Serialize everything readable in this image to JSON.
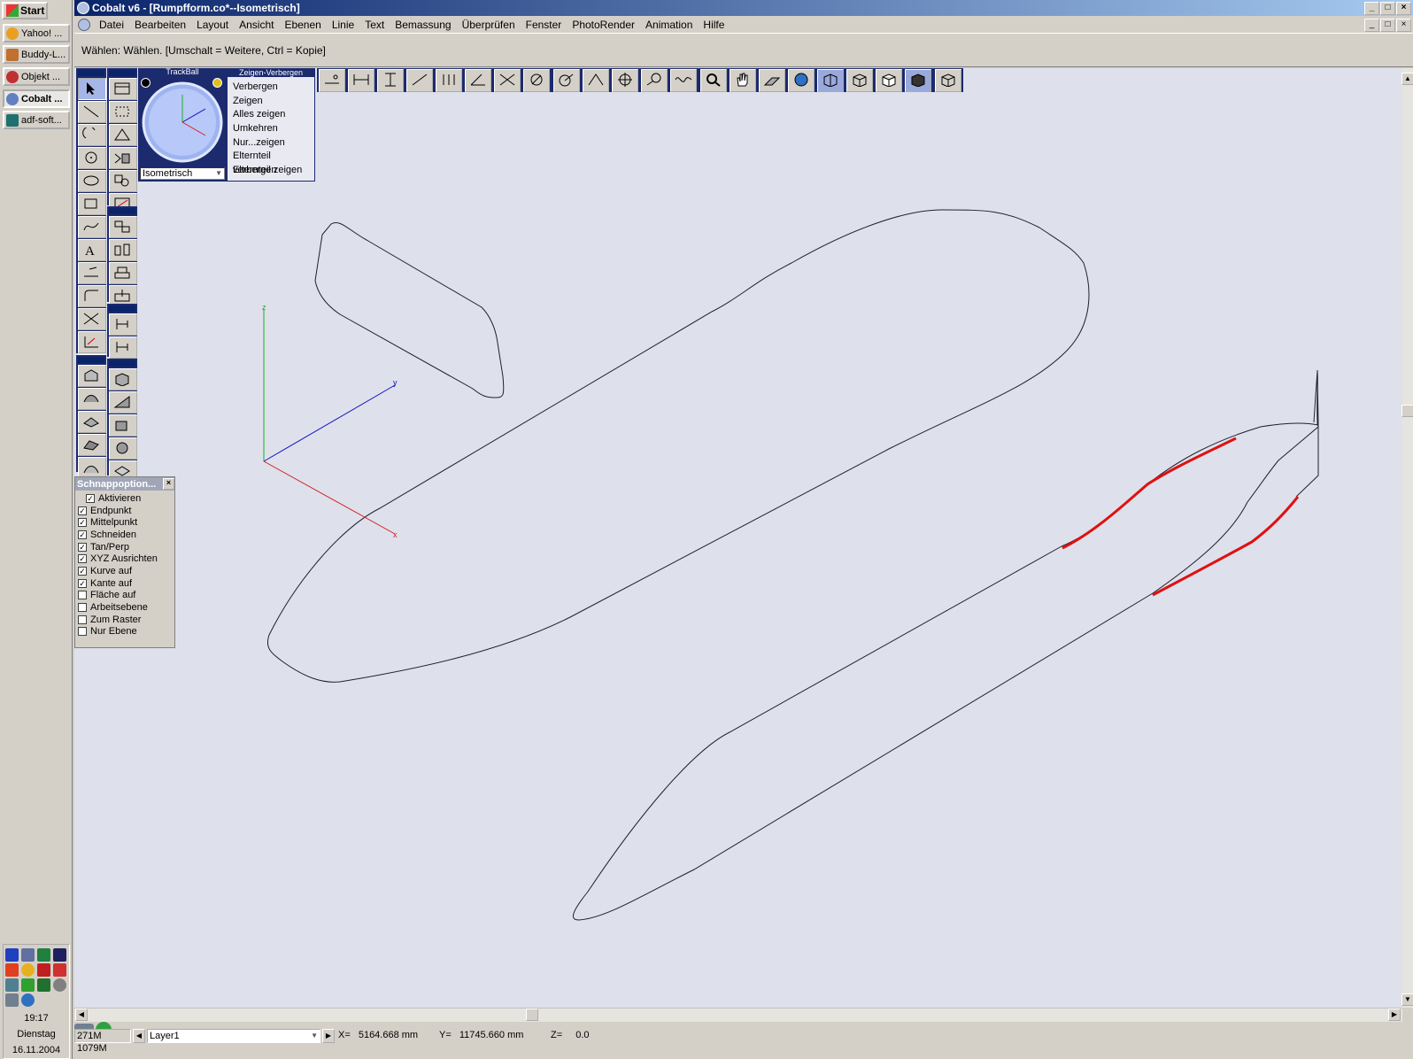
{
  "taskbar": {
    "start_label": "Start",
    "tasks": [
      {
        "label": "Yahoo! ...",
        "icon": "yahoo-messenger-icon",
        "color": "#e8a020"
      },
      {
        "label": "Buddy-L...",
        "icon": "buddy-icon",
        "color": "#c07030"
      },
      {
        "label": "Objekt ...",
        "icon": "objekt-icon",
        "color": "#c03030"
      },
      {
        "label": "Cobalt ...",
        "icon": "cobalt-icon",
        "color": "#6080c0",
        "active": true
      },
      {
        "label": "adf-soft...",
        "icon": "monitor-icon",
        "color": "#207070"
      }
    ],
    "clock": {
      "time": "19:17",
      "day": "Dienstag",
      "date": "16.11.2004"
    }
  },
  "window": {
    "title": "Cobalt v6 - [Rumpfform.co*--Isometrisch]",
    "menu": [
      "Datei",
      "Bearbeiten",
      "Layout",
      "Ansicht",
      "Ebenen",
      "Linie",
      "Text",
      "Bemassung",
      "Überprüfen",
      "Fenster",
      "PhotoRender",
      "Animation",
      "Hilfe"
    ],
    "prompt": "Wählen: Wählen. [Umschalt = Weitere, Ctrl = Kopie]"
  },
  "trackball": {
    "title": "TrackBall",
    "view": "Isometrisch"
  },
  "show_hide": {
    "title": "Zeigen-Verbergen",
    "items": [
      "Verbergen",
      "Zeigen",
      "Alles zeigen",
      "Umkehren",
      "Nur...zeigen",
      "Elternteil verbergen",
      "Elternteil zeigen"
    ]
  },
  "snap": {
    "title": "Schnappoption...",
    "activate": {
      "label": "Aktivieren",
      "checked": true
    },
    "options": [
      {
        "label": "Endpunkt",
        "checked": true
      },
      {
        "label": "Mittelpunkt",
        "checked": true
      },
      {
        "label": "Schneiden",
        "checked": true
      },
      {
        "label": "Tan/Perp",
        "checked": true
      },
      {
        "label": "XYZ Ausrichten",
        "checked": true
      },
      {
        "label": "Kurve auf",
        "checked": true
      },
      {
        "label": "Kante auf",
        "checked": true
      },
      {
        "label": "Fläche auf",
        "checked": false
      },
      {
        "label": "Arbeitsebene",
        "checked": false
      },
      {
        "label": "Zum Raster",
        "checked": false
      },
      {
        "label": "Nur Ebene",
        "checked": false
      }
    ]
  },
  "axes": {
    "z": "z",
    "y": "y",
    "x": "x"
  },
  "status": {
    "memory": "271M 1079M",
    "layer": "Layer1",
    "x_label": "X=",
    "x_value": "5164.668 mm",
    "y_label": "Y=",
    "y_value": "11745.660 mm",
    "z_label": "Z=",
    "z_value": "0.0"
  },
  "colors": {
    "viewport_bg": "#dee1ec",
    "curve": "#202030",
    "highlight": "#e01010",
    "axis_x": "#d02020",
    "axis_y": "#1010c0",
    "axis_z": "#20b020",
    "palette_bg": "#1c2a6e"
  }
}
